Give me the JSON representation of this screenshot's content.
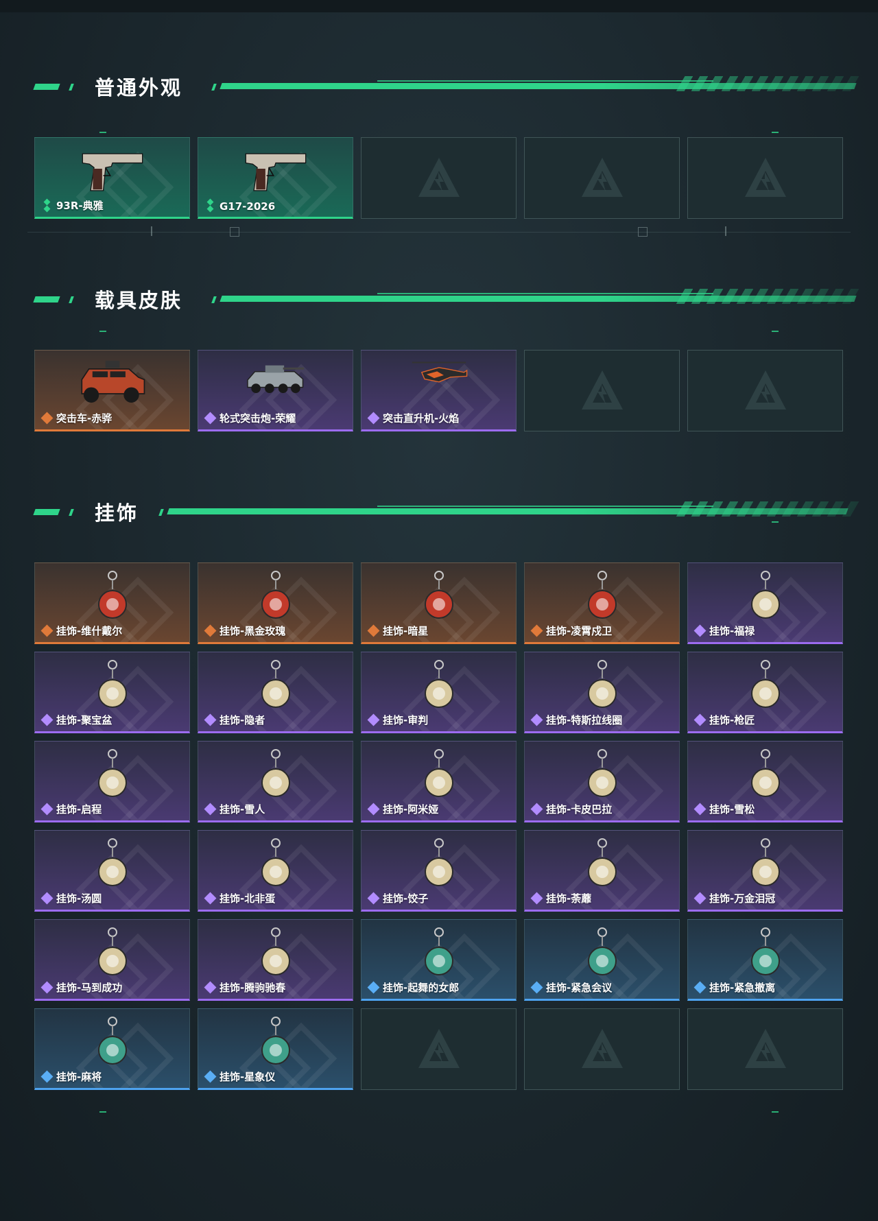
{
  "sections": [
    {
      "title": "普通外观",
      "items": [
        {
          "label": "93R-典雅",
          "rarity": "green",
          "icon": "pistol-icon"
        },
        {
          "label": "G17-2026",
          "rarity": "green",
          "icon": "pistol-icon"
        },
        {
          "label": "",
          "rarity": "empty"
        },
        {
          "label": "",
          "rarity": "empty"
        },
        {
          "label": "",
          "rarity": "empty"
        }
      ]
    },
    {
      "title": "载具皮肤",
      "items": [
        {
          "label": "突击车-赤骅",
          "rarity": "orange",
          "icon": "assault-vehicle-icon"
        },
        {
          "label": "轮式突击炮-荣耀",
          "rarity": "purple",
          "icon": "wheeled-assault-gun-icon"
        },
        {
          "label": "突击直升机-火焰",
          "rarity": "purple",
          "icon": "helicopter-icon"
        },
        {
          "label": "",
          "rarity": "empty"
        },
        {
          "label": "",
          "rarity": "empty"
        }
      ]
    },
    {
      "title": "挂饰",
      "items": [
        {
          "label": "挂饰-维什戴尔",
          "rarity": "orange",
          "icon": "charm-icon"
        },
        {
          "label": "挂饰-黑金玫瑰",
          "rarity": "orange",
          "icon": "charm-icon"
        },
        {
          "label": "挂饰-暗星",
          "rarity": "orange",
          "icon": "charm-icon"
        },
        {
          "label": "挂饰-凌霄戍卫",
          "rarity": "orange",
          "icon": "charm-icon"
        },
        {
          "label": "挂饰-福禄",
          "rarity": "purple",
          "icon": "charm-icon"
        },
        {
          "label": "挂饰-聚宝盆",
          "rarity": "purple",
          "icon": "charm-icon"
        },
        {
          "label": "挂饰-隐者",
          "rarity": "purple",
          "icon": "charm-icon"
        },
        {
          "label": "挂饰-审判",
          "rarity": "purple",
          "icon": "charm-icon"
        },
        {
          "label": "挂饰-特斯拉线圈",
          "rarity": "purple",
          "icon": "charm-icon"
        },
        {
          "label": "挂饰-枪匠",
          "rarity": "purple",
          "icon": "charm-icon"
        },
        {
          "label": "挂饰-启程",
          "rarity": "purple",
          "icon": "charm-icon"
        },
        {
          "label": "挂饰-雪人",
          "rarity": "purple",
          "icon": "charm-icon"
        },
        {
          "label": "挂饰-阿米娅",
          "rarity": "purple",
          "icon": "charm-icon"
        },
        {
          "label": "挂饰-卡皮巴拉",
          "rarity": "purple",
          "icon": "charm-icon"
        },
        {
          "label": "挂饰-雪松",
          "rarity": "purple",
          "icon": "charm-icon"
        },
        {
          "label": "挂饰-汤圆",
          "rarity": "purple",
          "icon": "charm-icon"
        },
        {
          "label": "挂饰-北非蛋",
          "rarity": "purple",
          "icon": "charm-icon"
        },
        {
          "label": "挂饰-饺子",
          "rarity": "purple",
          "icon": "charm-icon"
        },
        {
          "label": "挂饰-荼蘼",
          "rarity": "purple",
          "icon": "charm-icon"
        },
        {
          "label": "挂饰-万金泪冠",
          "rarity": "purple",
          "icon": "charm-icon"
        },
        {
          "label": "挂饰-马到成功",
          "rarity": "purple",
          "icon": "charm-icon"
        },
        {
          "label": "挂饰-腾驹驰春",
          "rarity": "purple",
          "icon": "charm-icon"
        },
        {
          "label": "挂饰-起舞的女郎",
          "rarity": "blue",
          "icon": "charm-icon"
        },
        {
          "label": "挂饰-紧急会议",
          "rarity": "blue",
          "icon": "charm-icon"
        },
        {
          "label": "挂饰-紧急撤离",
          "rarity": "blue",
          "icon": "charm-icon"
        },
        {
          "label": "挂饰-麻将",
          "rarity": "blue",
          "icon": "charm-icon"
        },
        {
          "label": "挂饰-星象仪",
          "rarity": "blue",
          "icon": "charm-icon"
        },
        {
          "label": "",
          "rarity": "empty"
        },
        {
          "label": "",
          "rarity": "empty"
        },
        {
          "label": "",
          "rarity": "empty"
        }
      ]
    }
  ],
  "colors": {
    "accent": "#2fd48a",
    "orange": "#e07a3a",
    "purple": "#9c6cf0",
    "blue": "#4ea3f0"
  }
}
